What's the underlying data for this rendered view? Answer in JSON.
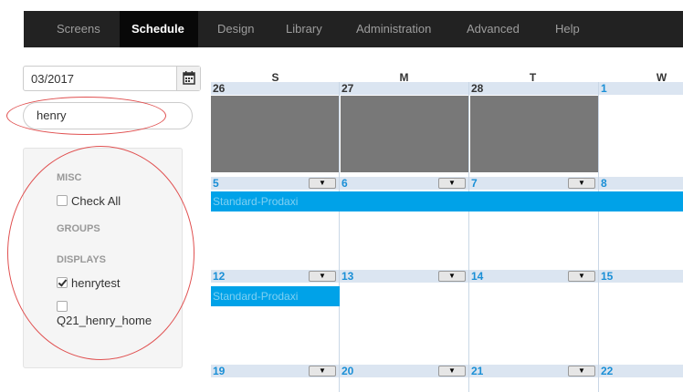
{
  "nav": {
    "tabs": [
      "Screens",
      "Schedule",
      "Design",
      "Library",
      "Administration",
      "Advanced",
      "Help"
    ],
    "active": "Schedule"
  },
  "sidebar": {
    "month_value": "03/2017",
    "calendar_icon": "calendar-icon",
    "search_value": "henry",
    "misc_header": "MISC",
    "check_all_label": "Check All",
    "groups_header": "GROUPS",
    "displays_header": "DISPLAYS",
    "displays": [
      {
        "label": "henrytest",
        "checked": true
      },
      {
        "label": "Q21_henry_home",
        "checked": false
      }
    ]
  },
  "calendar": {
    "weekdays": [
      "S",
      "M",
      "T",
      "W"
    ],
    "weeks": [
      {
        "days": [
          "26",
          "27",
          "28",
          "1"
        ],
        "dropdowns": false
      },
      {
        "days": [
          "5",
          "6",
          "7",
          "8"
        ],
        "dropdowns": true
      },
      {
        "days": [
          "12",
          "13",
          "14",
          "15"
        ],
        "dropdowns": true
      },
      {
        "days": [
          "19",
          "20",
          "21",
          "22"
        ],
        "dropdowns": true
      }
    ],
    "events": [
      {
        "label": "Standard-Prodaxi",
        "week": 1,
        "start_col": 0,
        "span": 4
      },
      {
        "label": "Standard-Prodaxi",
        "week": 2,
        "start_col": 0,
        "span": 1
      }
    ],
    "colors": {
      "header_bg": "#dbe5f1",
      "prev_month_text": "#333333",
      "current_month_text": "#1a8fd6",
      "disabled_days_bg": "#787878",
      "event_bg": "#00a2e8",
      "event_text": "#7fd0f2"
    }
  },
  "colors": {
    "nav_bg": "#222222",
    "nav_active_bg": "#080808",
    "annotation": "#e05050"
  }
}
